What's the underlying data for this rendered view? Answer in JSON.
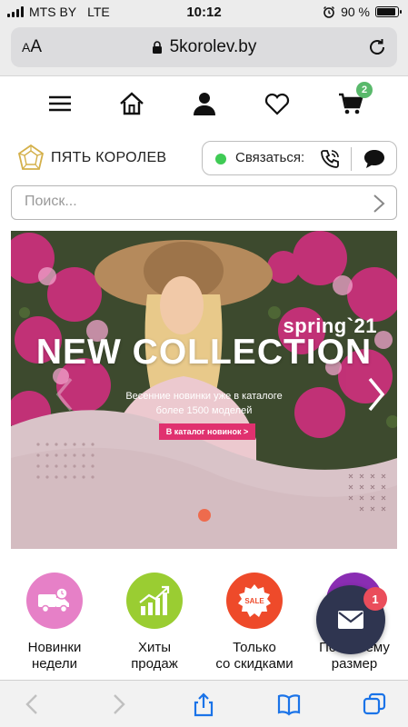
{
  "status_bar": {
    "carrier": "MTS BY",
    "network": "LTE",
    "time": "10:12",
    "battery": "90 %",
    "battery_level": 0.9
  },
  "browser": {
    "text_size_label": "AA",
    "url": "5korolev.by"
  },
  "header": {
    "cart_count": "2",
    "brand_name": "ПЯТЬ КОРОЛЕВ",
    "contact_label": "Связаться:"
  },
  "search": {
    "placeholder": "Поиск..."
  },
  "banner": {
    "season": "spring`21",
    "headline": "NEW COLLECTION",
    "subtitle_line1": "Весенние новинки уже в каталоге",
    "subtitle_line2": "более 1500 моделей",
    "cta": "В каталог новинок >"
  },
  "categories": [
    {
      "label_line1": "Новинки",
      "label_line2": "недели",
      "icon": "delivery-truck-icon",
      "color": "#e680c7"
    },
    {
      "label_line1": "Хиты",
      "label_line2": "продаж",
      "icon": "growth-chart-icon",
      "color": "#9acd32"
    },
    {
      "label_line1": "Только",
      "label_line2": "со скидками",
      "icon": "sale-badge-icon",
      "color": "#ee4a2a"
    },
    {
      "label_line1": "По вашему",
      "label_line2": "размер",
      "icon": "size-icon",
      "color": "#8a2db3"
    }
  ],
  "chat": {
    "badge_count": "1"
  },
  "colors": {
    "accent_green": "#59b96b",
    "online_dot": "#3fcb55",
    "cta_pink": "#e0316f",
    "fab_navy": "#2f3550",
    "badge_red": "#ea4d5b"
  }
}
